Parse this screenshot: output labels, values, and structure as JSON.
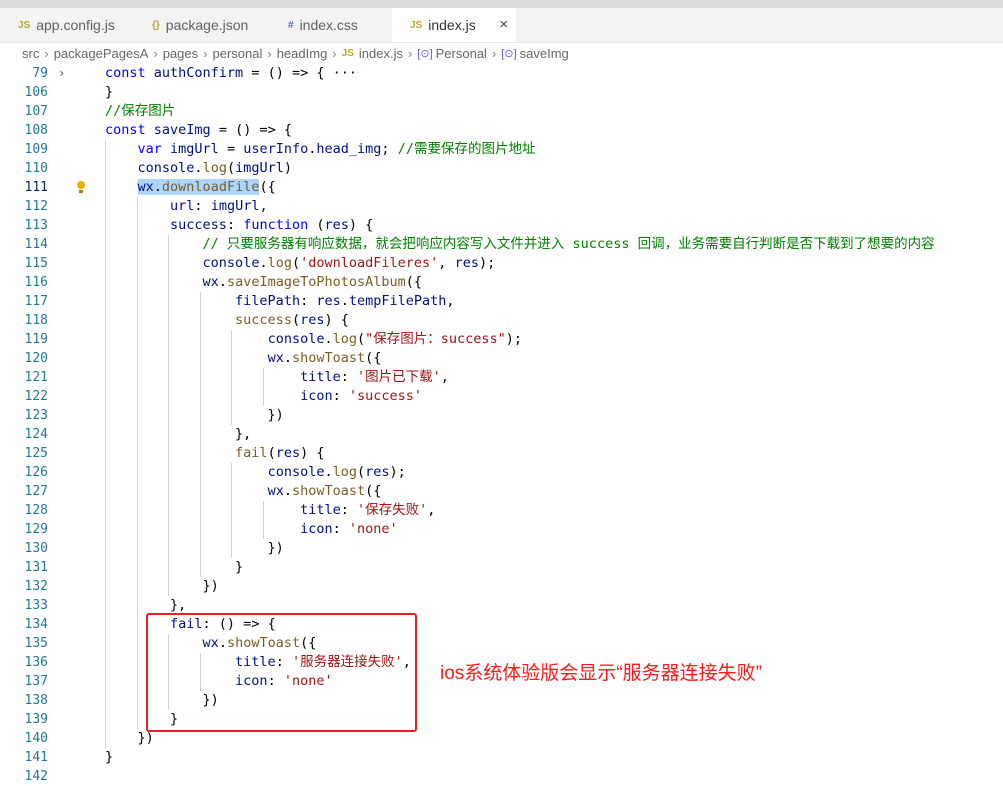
{
  "tabs": [
    {
      "icon_text": "JS",
      "icon": "js-file-icon",
      "label": "app.config.js",
      "active": false
    },
    {
      "icon_text": "{}",
      "icon": "json-file-icon",
      "label": "package.json",
      "active": false
    },
    {
      "icon_text": "#",
      "icon": "css-file-icon",
      "label": "index.css",
      "active": false
    },
    {
      "icon_text": "JS",
      "icon": "js-file-icon",
      "label": "index.js",
      "active": true,
      "close": "×"
    }
  ],
  "breadcrumb": {
    "parts": [
      "src",
      "packagePagesA",
      "pages",
      "personal",
      "headImg",
      "index.js",
      "Personal",
      "saveImg"
    ],
    "file_icon_text": "JS"
  },
  "lines": [
    {
      "n": "79",
      "folded": true,
      "code": "const authConfirm = () => { ···"
    },
    {
      "n": "106",
      "code": "}"
    },
    {
      "n": "107",
      "code": "//保存图片"
    },
    {
      "n": "108",
      "code": "const saveImg = () => {"
    },
    {
      "n": "109",
      "code": "    var imgUrl = userInfo.head_img; //需要保存的图片地址"
    },
    {
      "n": "110",
      "code": "    console.log(imgUrl)"
    },
    {
      "n": "111",
      "current": true,
      "code": "    wx.downloadFile({"
    },
    {
      "n": "112",
      "code": "        url: imgUrl,"
    },
    {
      "n": "113",
      "code": "        success: function (res) {"
    },
    {
      "n": "114",
      "code": "            // 只要服务器有响应数据，就会把响应内容写入文件并进入 success 回调，业务需要自行判断是否下载到了想要的内容"
    },
    {
      "n": "115",
      "code": "            console.log('downloadFileres', res);"
    },
    {
      "n": "116",
      "code": "            wx.saveImageToPhotosAlbum({"
    },
    {
      "n": "117",
      "code": "                filePath: res.tempFilePath,"
    },
    {
      "n": "118",
      "code": "                success(res) {"
    },
    {
      "n": "119",
      "code": "                    console.log(\"保存图片：success\");"
    },
    {
      "n": "120",
      "code": "                    wx.showToast({"
    },
    {
      "n": "121",
      "code": "                        title: '图片已下载',"
    },
    {
      "n": "122",
      "code": "                        icon: 'success'"
    },
    {
      "n": "123",
      "code": "                    })"
    },
    {
      "n": "124",
      "code": "                },"
    },
    {
      "n": "125",
      "code": "                fail(res) {"
    },
    {
      "n": "126",
      "code": "                    console.log(res);"
    },
    {
      "n": "127",
      "code": "                    wx.showToast({"
    },
    {
      "n": "128",
      "code": "                        title: '保存失败',"
    },
    {
      "n": "129",
      "code": "                        icon: 'none'"
    },
    {
      "n": "130",
      "code": "                    })"
    },
    {
      "n": "131",
      "code": "                }"
    },
    {
      "n": "132",
      "code": "            })"
    },
    {
      "n": "133",
      "code": "        },"
    },
    {
      "n": "134",
      "code": "        fail: () => {"
    },
    {
      "n": "135",
      "code": "            wx.showToast({"
    },
    {
      "n": "136",
      "code": "                title: '服务器连接失败',"
    },
    {
      "n": "137",
      "code": "                icon: 'none'"
    },
    {
      "n": "138",
      "code": "            })"
    },
    {
      "n": "139",
      "code": "        }"
    },
    {
      "n": "140",
      "code": "    })"
    },
    {
      "n": "141",
      "code": "}"
    },
    {
      "n": "142",
      "code": ""
    }
  ],
  "annotation": "ios系统体验版会显示“服务器连接失败”",
  "colors": {
    "annotation": "#ff1a1a",
    "line_number": "#237893",
    "selection": "#add6ff"
  }
}
